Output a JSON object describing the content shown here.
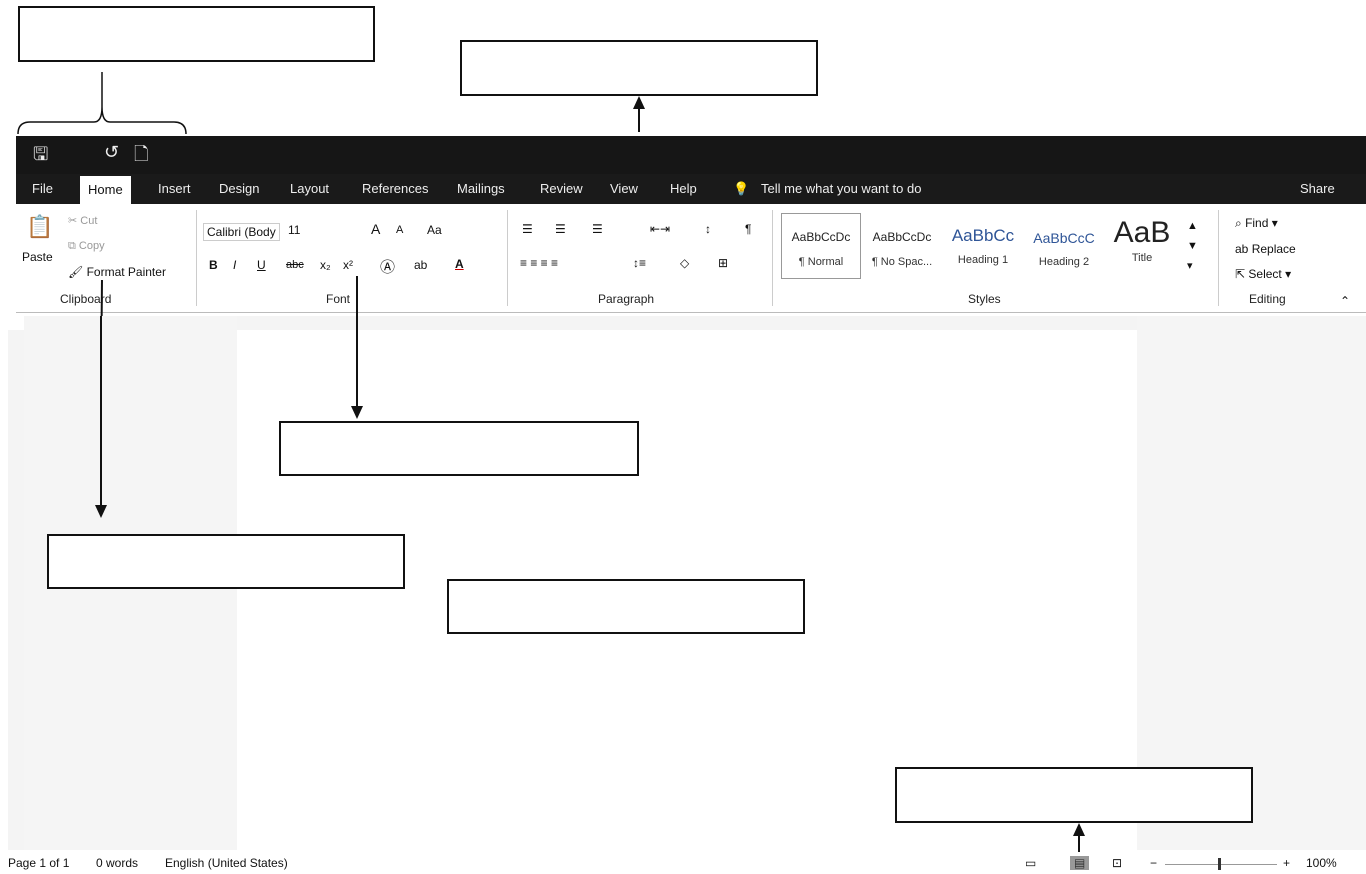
{
  "quick_access": {
    "save_icon": "save-icon",
    "undo_icon": "undo-icon",
    "preview_icon": "print-preview-icon"
  },
  "tabs": [
    {
      "label": "File"
    },
    {
      "label": "Home"
    },
    {
      "label": "Insert"
    },
    {
      "label": "Design"
    },
    {
      "label": "Layout"
    },
    {
      "label": "References"
    },
    {
      "label": "Mailings"
    },
    {
      "label": "Review"
    },
    {
      "label": "View"
    },
    {
      "label": "Help"
    }
  ],
  "tell_me": "Tell me what you want to do",
  "share": "Share",
  "clipboard": {
    "paste": "Paste",
    "cut": "Cut",
    "copy": "Copy",
    "format_painter": "Format Painter",
    "group": "Clipboard"
  },
  "font": {
    "name": "Calibri (Body",
    "size": "11",
    "grow": "A",
    "shrink": "A",
    "case": "Aa",
    "bold": "B",
    "italic": "I",
    "underline": "U",
    "strike": "abc",
    "sub": "x₂",
    "sup": "x²",
    "group": "Font"
  },
  "paragraph": {
    "group": "Paragraph",
    "pilcrow": "¶"
  },
  "styles": {
    "items": [
      {
        "preview": "AaBbCcDc",
        "name": "¶ Normal"
      },
      {
        "preview": "AaBbCcDc",
        "name": "¶ No Spac..."
      },
      {
        "preview": "AaBbCc",
        "name": "Heading 1"
      },
      {
        "preview": "AaBbCcC",
        "name": "Heading 2"
      },
      {
        "preview": "AaB",
        "name": "Title"
      }
    ],
    "group": "Styles"
  },
  "editing": {
    "find": "Find",
    "replace": "Replace",
    "select": "Select",
    "group": "Editing"
  },
  "status": {
    "page": "Page 1 of 1",
    "words": "0 words",
    "language": "English (United States)",
    "zoom": "100%"
  }
}
